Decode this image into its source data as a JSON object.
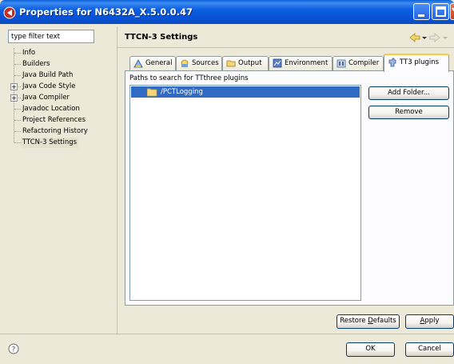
{
  "window": {
    "title": "Properties for N6432A_X.5.0.0.47",
    "controls": [
      "minimize-icon",
      "maximize-icon",
      "close-icon"
    ]
  },
  "sidebar": {
    "filter": {
      "value": "type filter text",
      "placeholder": "type filter text"
    },
    "items": [
      {
        "label": "Info",
        "expandable": false
      },
      {
        "label": "Builders",
        "expandable": false
      },
      {
        "label": "Java Build Path",
        "expandable": false
      },
      {
        "label": "Java Code Style",
        "expandable": true
      },
      {
        "label": "Java Compiler",
        "expandable": true
      },
      {
        "label": "Javadoc Location",
        "expandable": false
      },
      {
        "label": "Project References",
        "expandable": false
      },
      {
        "label": "Refactoring History",
        "expandable": false
      },
      {
        "label": "TTCN-3 Settings",
        "expandable": false,
        "selected": true
      }
    ],
    "expander_symbol": "+"
  },
  "main": {
    "title": "TTCN-3 Settings",
    "tabs": [
      {
        "label": "General",
        "icon": "general-icon"
      },
      {
        "label": "Sources",
        "icon": "sources-icon"
      },
      {
        "label": "Output",
        "icon": "folder-icon"
      },
      {
        "label": "Environment",
        "icon": "environment-icon"
      },
      {
        "label": "Compiler",
        "icon": "compiler-icon"
      },
      {
        "label": "TT3 plugins",
        "icon": "plugin-icon",
        "active": true
      }
    ],
    "panel_label": "Paths to search for TTthree plugins",
    "plugin_paths": [
      "/PCTLogging"
    ],
    "buttons": {
      "add_folder": "Add Folder...",
      "remove": "Remove"
    }
  },
  "footer": {
    "restore_defaults_pre": "Restore ",
    "restore_defaults_mnemonic": "D",
    "restore_defaults_post": "efaults",
    "apply_mnemonic": "A",
    "apply_post": "pply",
    "ok": "OK",
    "cancel": "Cancel"
  },
  "colors": {
    "titlebar": "#0752d6",
    "selection": "#316ac5",
    "active_tab_accent": "#ffc83c",
    "dialog_bg": "#ece9d8"
  }
}
